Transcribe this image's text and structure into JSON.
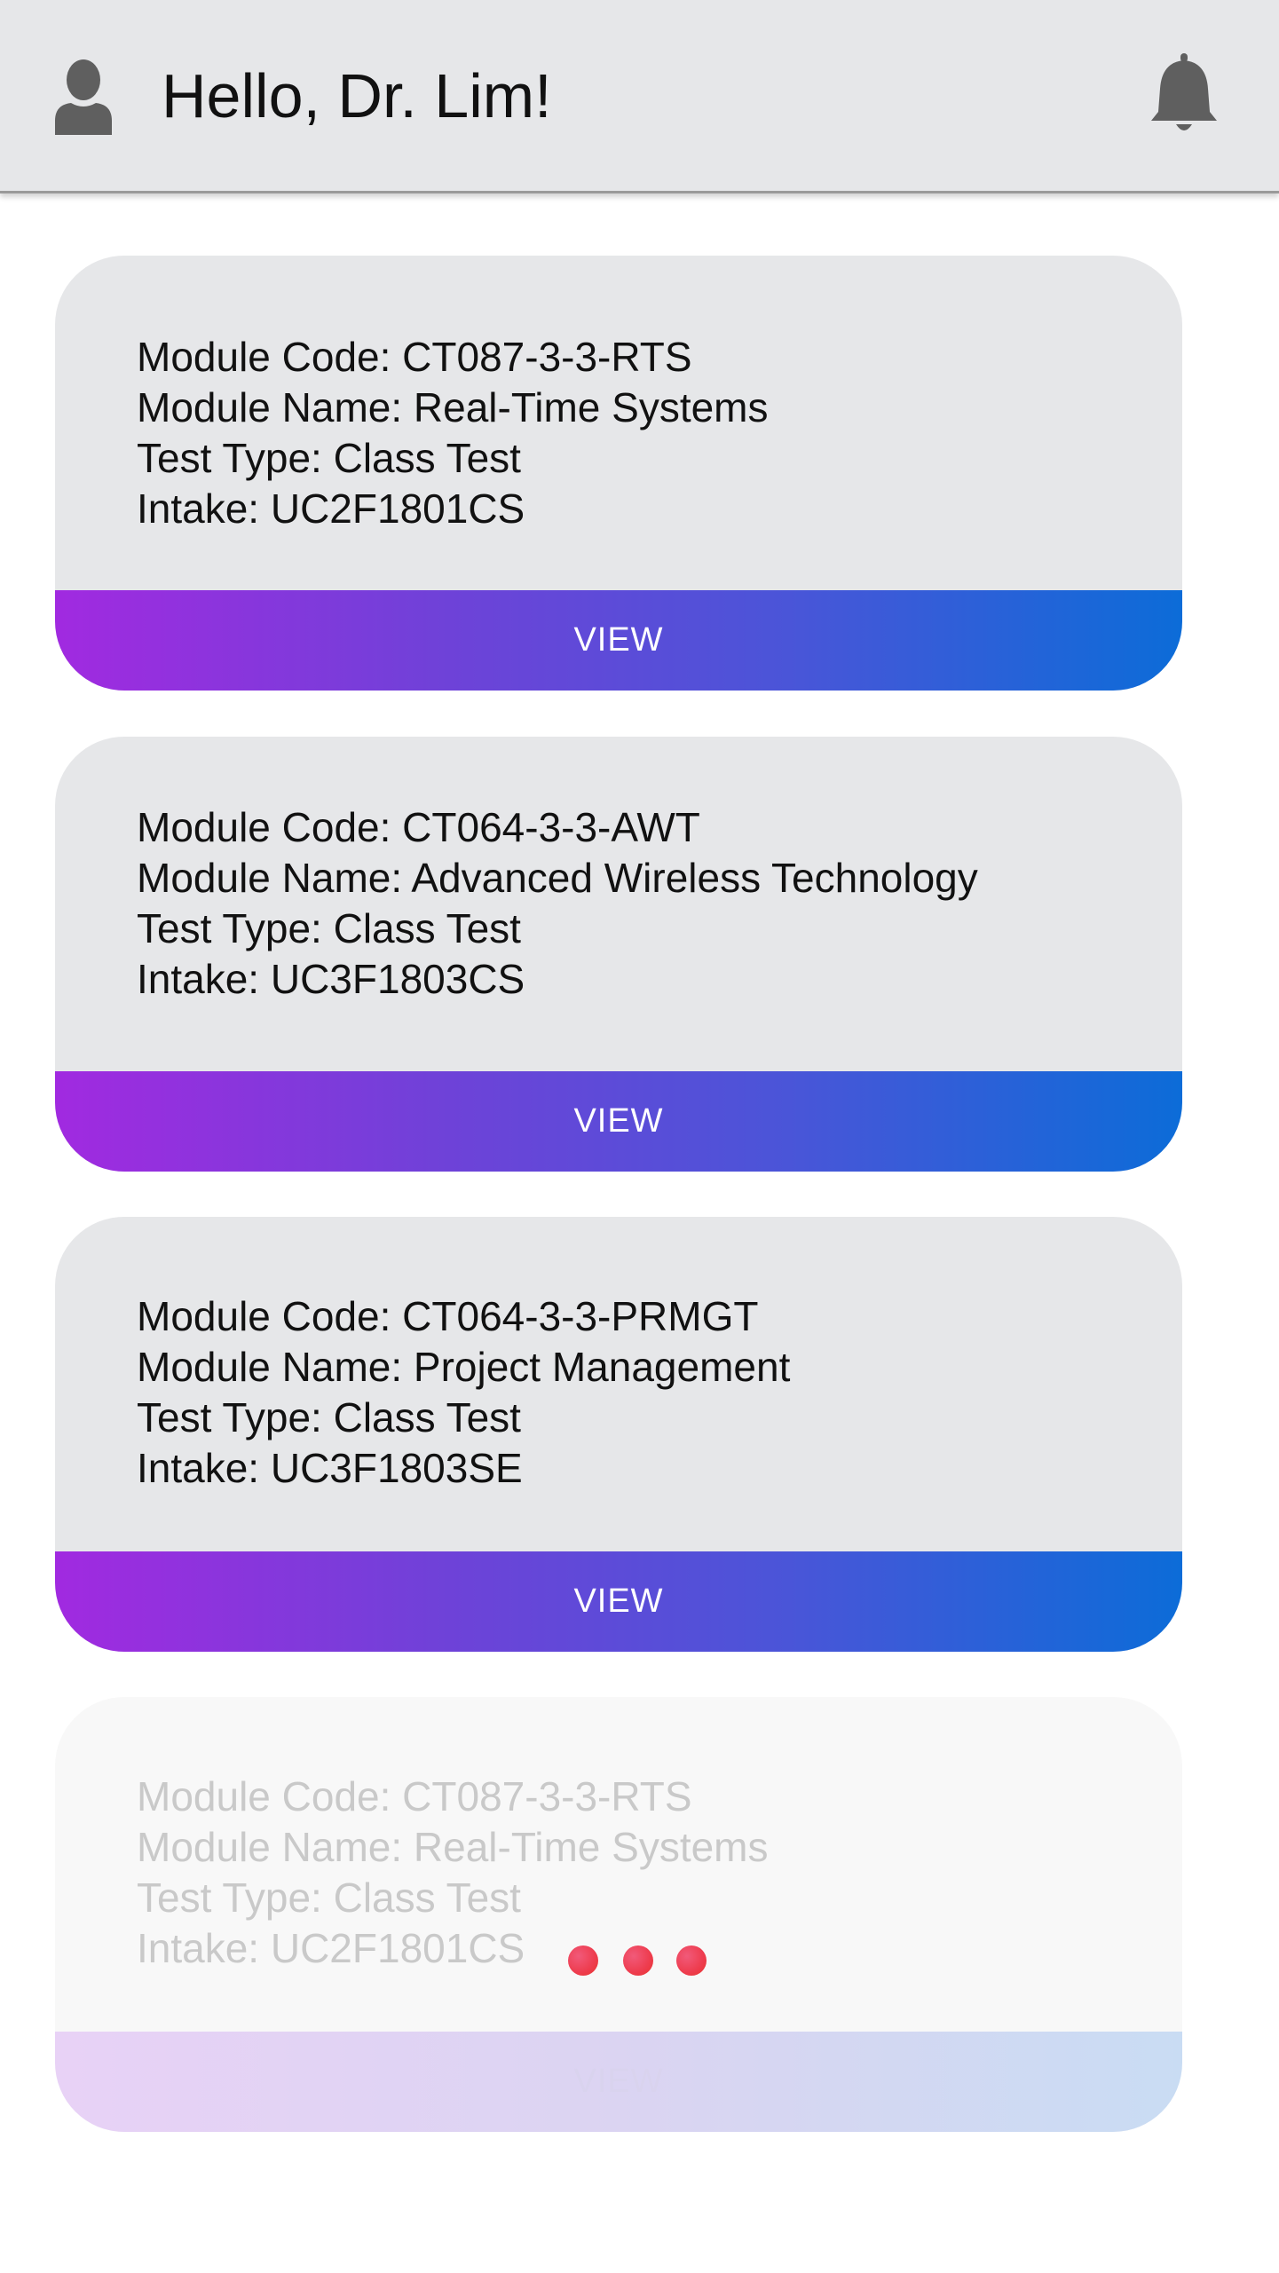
{
  "header": {
    "greeting": "Hello, Dr. Lim!",
    "avatar_icon": "user-avatar-icon",
    "notification_icon": "bell-icon"
  },
  "cards": [
    {
      "module_code": "Module Code: CT087-3-3-RTS",
      "module_name": "Module Name: Real-Time Systems",
      "test_type": "Test Type: Class Test",
      "intake": "Intake: UC2F1801CS",
      "button_label": "VIEW"
    },
    {
      "module_code": "Module Code: CT064-3-3-AWT",
      "module_name": "Module Name: Advanced Wireless Technology",
      "test_type": "Test Type: Class Test",
      "intake": "Intake: UC3F1803CS",
      "button_label": "VIEW"
    },
    {
      "module_code": "Module Code: CT064-3-3-PRMGT",
      "module_name": "Module Name: Project Management",
      "test_type": "Test Type: Class Test",
      "intake": "Intake: UC3F1803SE",
      "button_label": "VIEW"
    },
    {
      "module_code": "Module Code: CT087-3-3-RTS",
      "module_name": "Module Name: Real-Time Systems",
      "test_type": "Test Type: Class Test",
      "intake": "Intake: UC2F1801CS",
      "button_label": "VIEW"
    }
  ],
  "loading_indicator": {
    "icon": "loading-dots-icon"
  },
  "colors": {
    "header_bg": "#e6e7e9",
    "card_bg": "#e6e7e9",
    "button_gradient_start": "#a12ae0",
    "button_gradient_end": "#0c6cd8",
    "loading_dot": "#ee3c4e",
    "icon_gray": "#5f5f5f"
  }
}
